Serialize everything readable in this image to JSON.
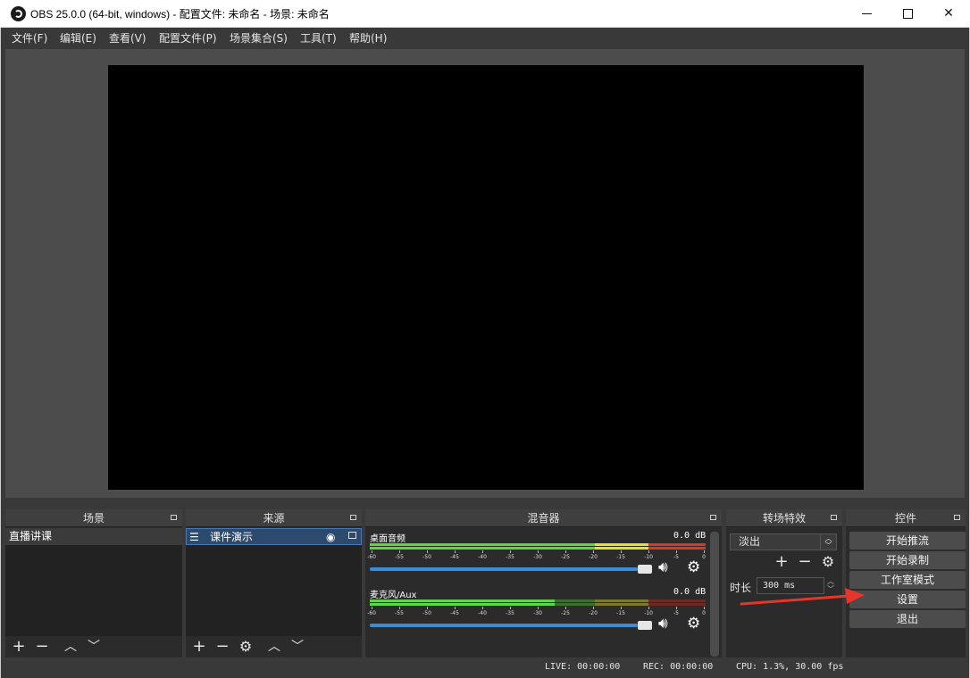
{
  "window": {
    "title": "OBS 25.0.0 (64-bit, windows) - 配置文件: 未命名 - 场景: 未命名",
    "min_label": "",
    "max_label": "",
    "close_label": "✕"
  },
  "menu": [
    "文件(F)",
    "编辑(E)",
    "查看(V)",
    "配置文件(P)",
    "场景集合(S)",
    "工具(T)",
    "帮助(H)"
  ],
  "docks": {
    "scenes": {
      "title": "场景",
      "items": [
        "直播讲课"
      ]
    },
    "sources": {
      "title": "来源",
      "items": [
        "课件演示"
      ]
    },
    "mixer": {
      "title": "混音器",
      "channels": [
        {
          "name": "桌面音频",
          "db": "0.0 dB"
        },
        {
          "name": "麦克风/Aux",
          "db": "0.0 dB"
        }
      ],
      "ticks": [
        "-60",
        "-55",
        "-50",
        "-45",
        "-40",
        "-35",
        "-30",
        "-25",
        "-20",
        "-15",
        "-10",
        "-5",
        "0"
      ]
    },
    "transitions": {
      "title": "转场特效",
      "selected": "淡出",
      "duration_label": "时长",
      "duration_value": "300 ms"
    },
    "controls": {
      "title": "控件",
      "buttons": [
        "开始推流",
        "开始录制",
        "工作室模式",
        "设置",
        "退出"
      ]
    }
  },
  "status": {
    "live": "LIVE: 00:00:00",
    "rec": "REC: 00:00:00",
    "cpu": "CPU: 1.3%, 30.00 fps"
  },
  "colors": {
    "accent_blue": "#3b8bd6",
    "arrow_red": "#e8352a",
    "meter_green": "#5fd53f",
    "meter_yellow": "#e3e03a",
    "meter_red": "#d23a2a"
  }
}
